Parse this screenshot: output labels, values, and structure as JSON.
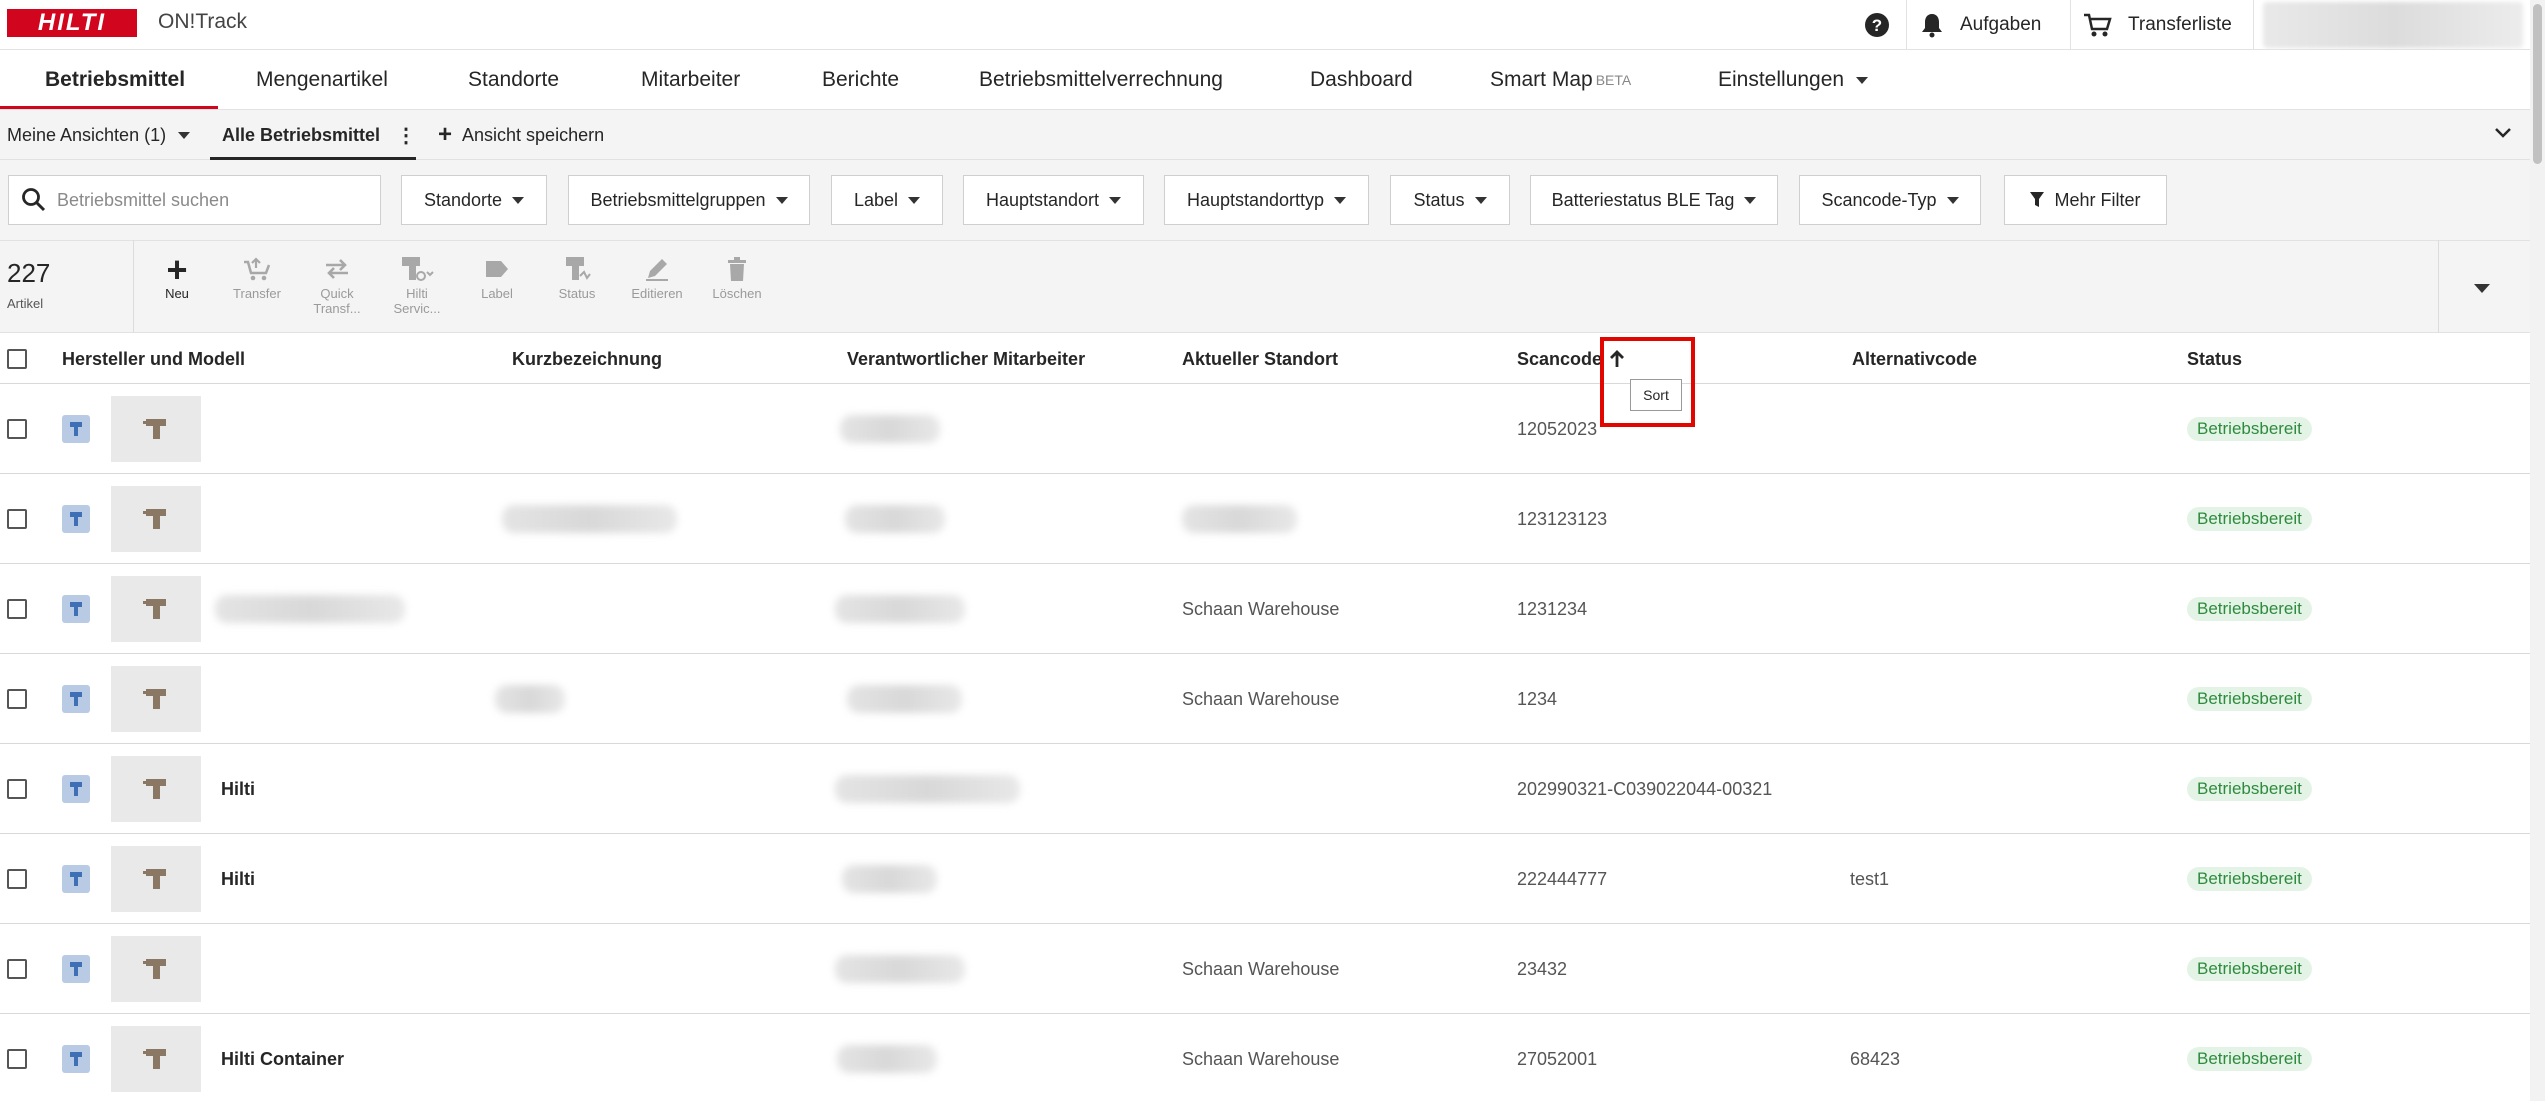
{
  "header": {
    "logo_text": "HILTI",
    "app_name": "ON!Track",
    "help_icon": "question-circle-icon",
    "tasks_label": "Aufgaben",
    "transfer_label": "Transferliste"
  },
  "nav": {
    "tabs": [
      "Betriebsmittel",
      "Mengenartikel",
      "Standorte",
      "Mitarbeiter",
      "Berichte",
      "Betriebsmittelverrechnung",
      "Dashboard",
      "Smart Map",
      "Einstellungen"
    ],
    "beta_label": "BETA",
    "active": "Betriebsmittel"
  },
  "views": {
    "my_views": "Meine Ansichten (1)",
    "all_assets": "Alle Betriebsmittel",
    "save_view": "Ansicht speichern"
  },
  "filters": {
    "search_placeholder": "Betriebsmittel suchen",
    "buttons": [
      "Standorte",
      "Betriebsmittelgruppen",
      "Label",
      "Hauptstandort",
      "Hauptstandorttyp",
      "Status",
      "Batteriestatus BLE Tag",
      "Scancode-Typ"
    ],
    "more_filters": "Mehr Filter"
  },
  "toolbar": {
    "count": "227",
    "count_label": "Artikel",
    "actions": [
      "Neu",
      "Transfer",
      "Quick Transf...",
      "Hilti Servic...",
      "Label",
      "Status",
      "Editieren",
      "Löschen"
    ]
  },
  "table": {
    "columns": [
      "Hersteller und Modell",
      "Kurzbezeichnung",
      "Verantwortlicher Mitarbeiter",
      "Aktueller Standort",
      "Scancode",
      "Alternativcode",
      "Status"
    ],
    "sort_tooltip": "Sort",
    "rows": [
      {
        "manufacturer": "",
        "location": "",
        "scancode": "12052023",
        "altcode": "",
        "status": "Betriebsbereit"
      },
      {
        "manufacturer": "",
        "location": "",
        "scancode": "123123123",
        "altcode": "",
        "status": "Betriebsbereit"
      },
      {
        "manufacturer": "",
        "location": "Schaan Warehouse",
        "scancode": "1231234",
        "altcode": "",
        "status": "Betriebsbereit"
      },
      {
        "manufacturer": "",
        "location": "Schaan Warehouse",
        "scancode": "1234",
        "altcode": "",
        "status": "Betriebsbereit"
      },
      {
        "manufacturer": "Hilti",
        "location": "",
        "scancode": "202990321-C039022044-00321",
        "altcode": "",
        "status": "Betriebsbereit"
      },
      {
        "manufacturer": "Hilti",
        "location": "",
        "scancode": "222444777",
        "altcode": "test1",
        "status": "Betriebsbereit"
      },
      {
        "manufacturer": "",
        "location": "Schaan Warehouse",
        "scancode": "23432",
        "altcode": "",
        "status": "Betriebsbereit"
      },
      {
        "manufacturer": "Hilti Container",
        "location": "Schaan Warehouse",
        "scancode": "27052001",
        "altcode": "68423",
        "status": "Betriebsbereit"
      }
    ]
  }
}
